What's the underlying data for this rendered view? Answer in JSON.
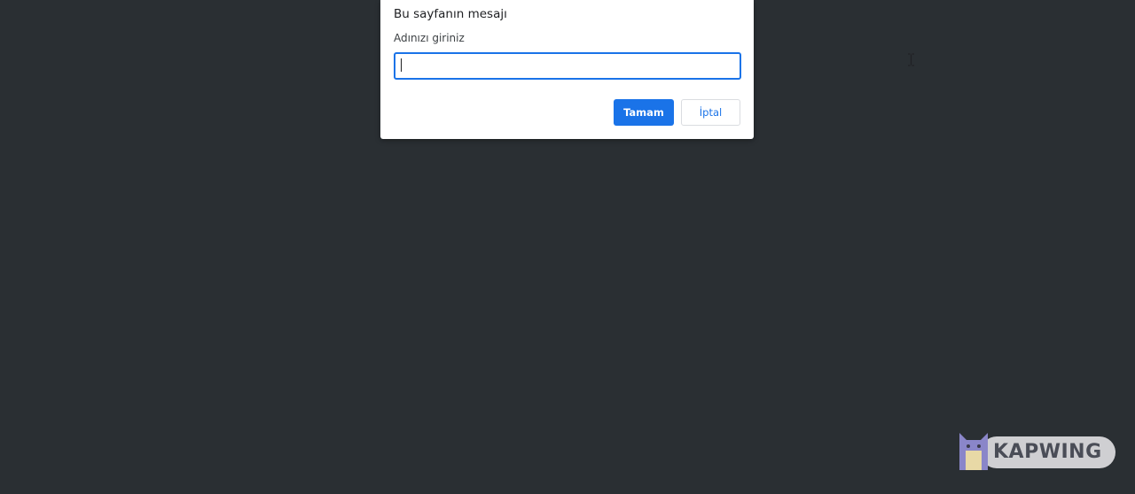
{
  "dialog": {
    "title": "Bu sayfanın mesajı",
    "message": "Adınızı giriniz",
    "input_value": "",
    "ok_label": "Tamam",
    "cancel_label": "İptal"
  },
  "watermark": {
    "text": "KAPWING",
    "icon": "kapwing-cat-icon"
  },
  "colors": {
    "background": "#2a2f33",
    "accent": "#1a73e8",
    "dialog_bg": "#ffffff"
  }
}
